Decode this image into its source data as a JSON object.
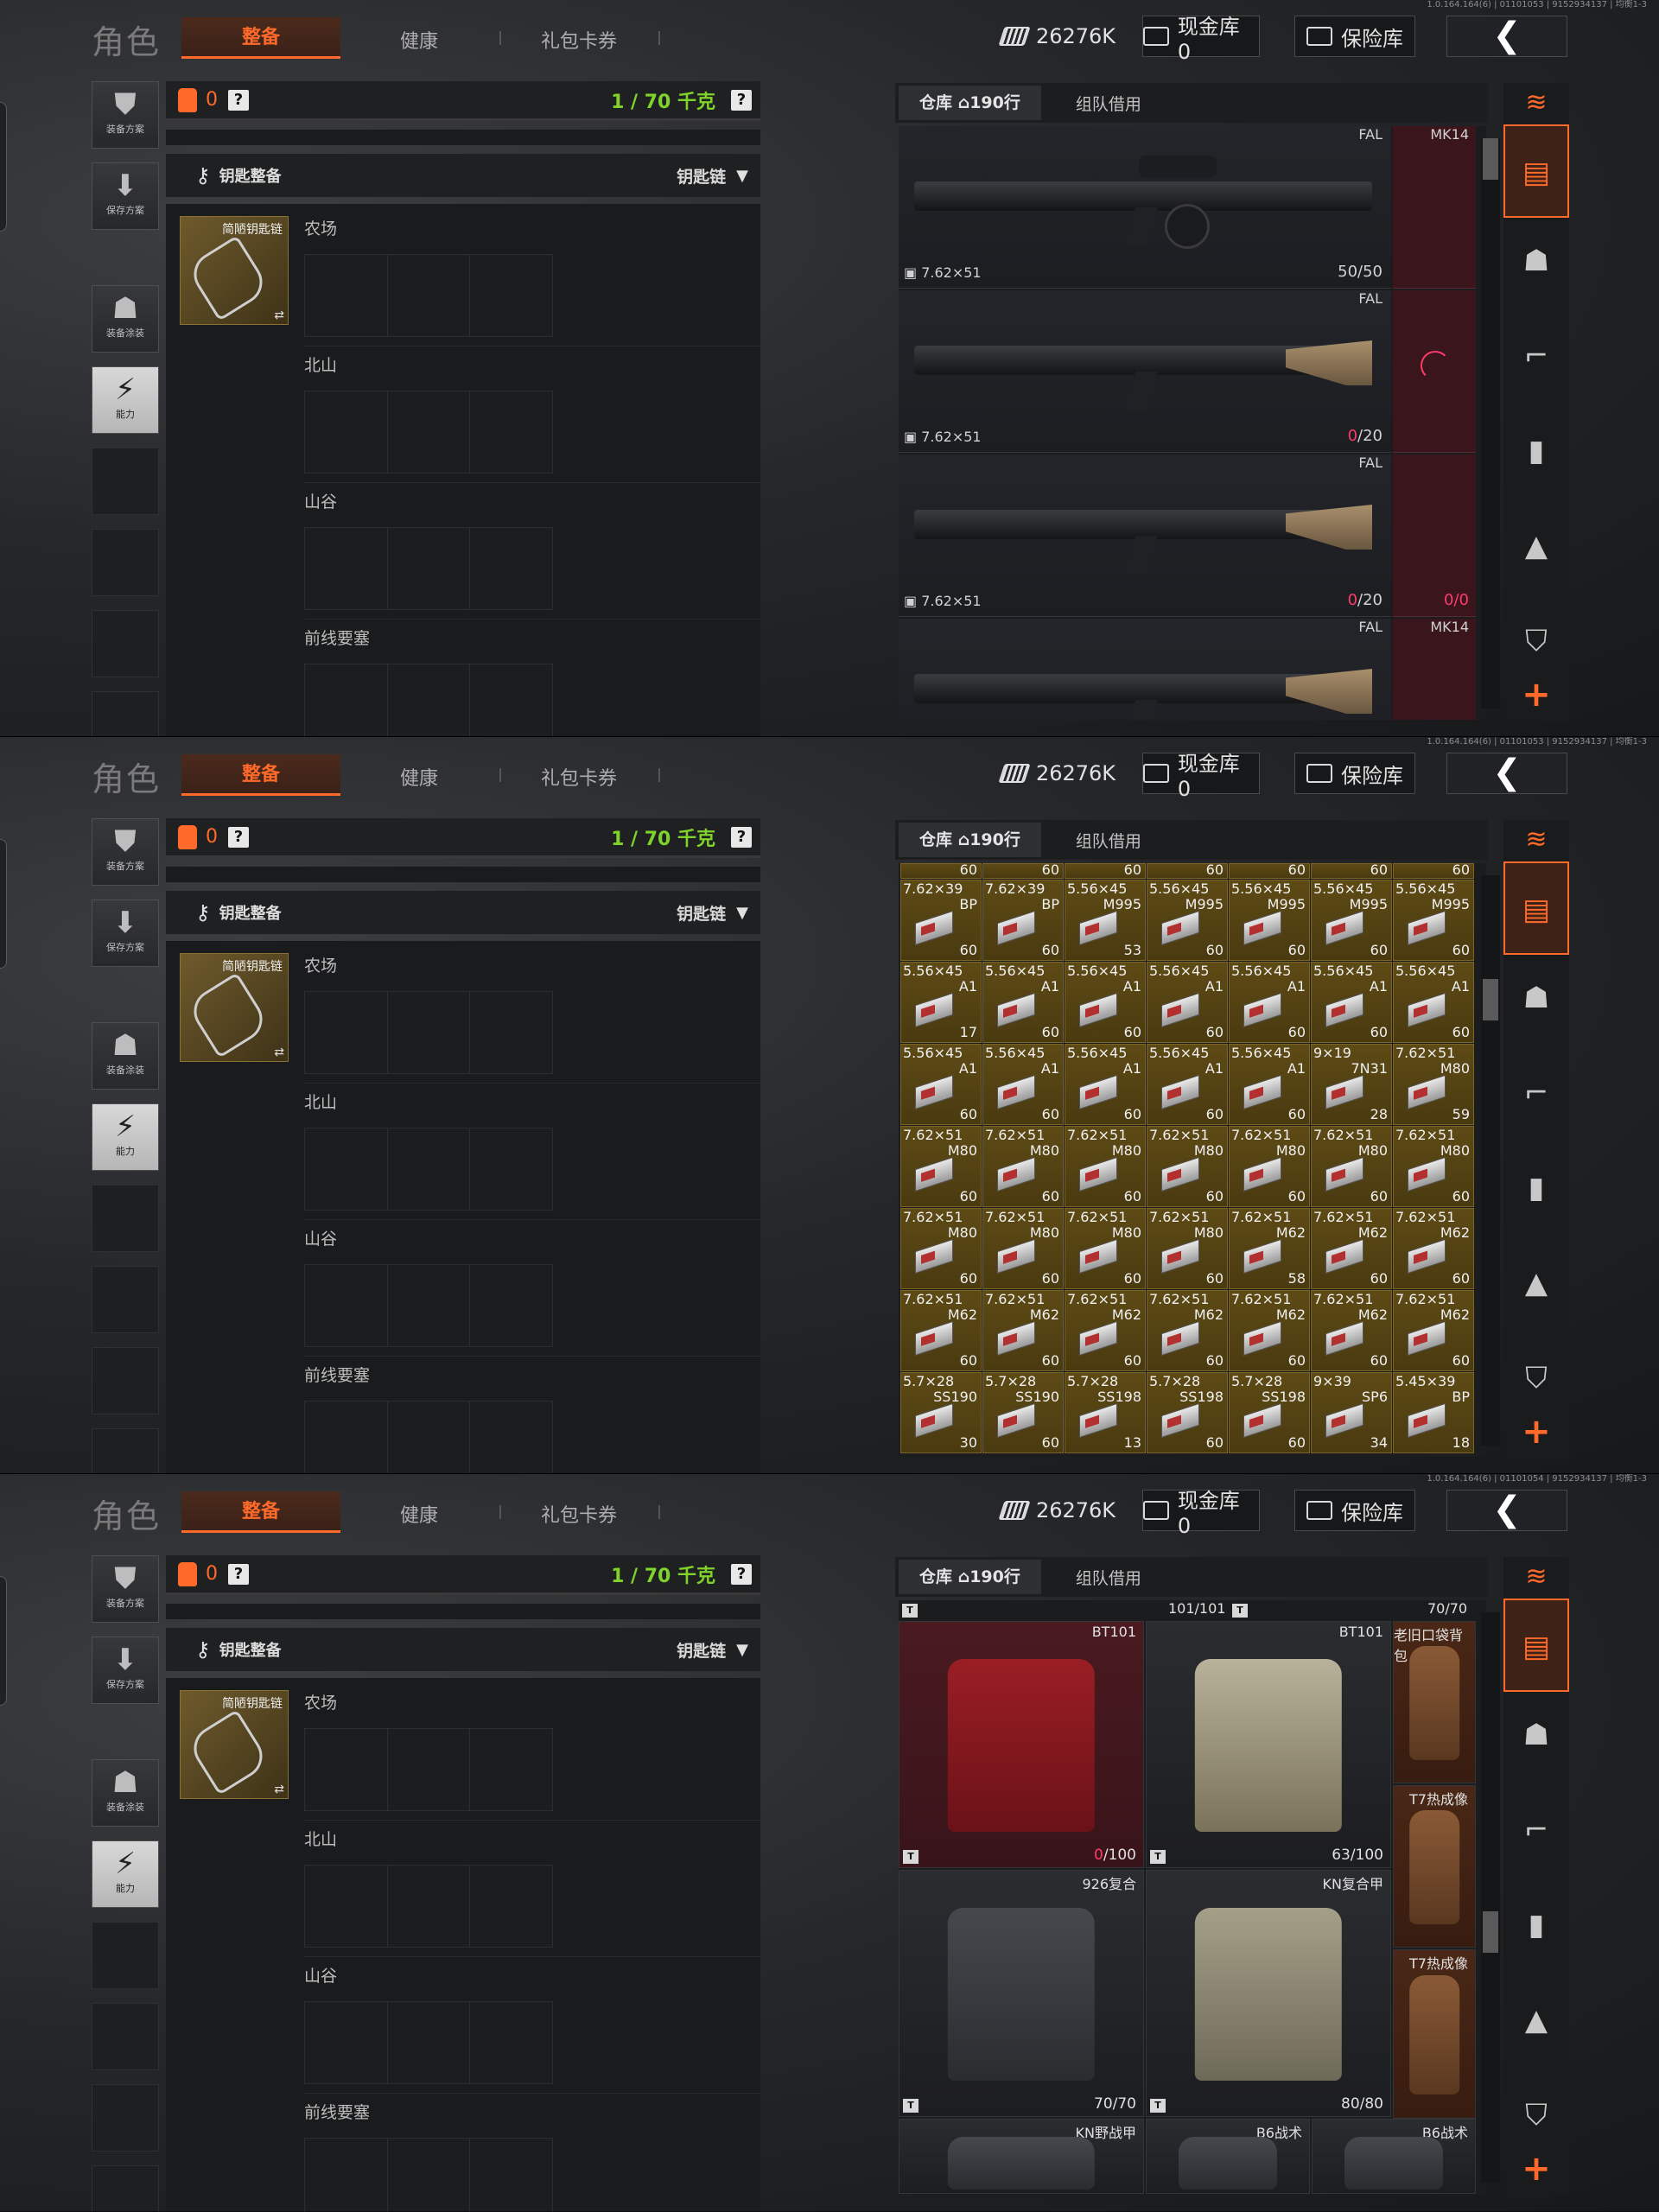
{
  "screens": [
    {
      "version": "1.0.164.164(6) | 01101053 | 9152934137 | 均衡1-3"
    },
    {
      "version": "1.0.164.164(6) | 01101053 | 9152934137 | 均衡1-3"
    },
    {
      "version": "1.0.164.164(6) | 01101054 | 9152934137 | 均衡1-3"
    }
  ],
  "nav": {
    "title": "角色",
    "tab_active": "整备",
    "tab_health": "健康",
    "tab_gift": "礼包卡券",
    "cash": "26276K",
    "gold_vault": "现金库 0",
    "safe_vault": "保险库",
    "back": "❮"
  },
  "sidebar": {
    "loadout": "装备方案",
    "save": "保存方案",
    "skin": "装备涂装",
    "ability": "能力"
  },
  "weight": {
    "count": "0",
    "value": "1 / 70 千克",
    "help": "?"
  },
  "keys": {
    "header": "钥匙整备",
    "chain": "钥匙链",
    "item_name": "简陋钥匙链",
    "sections": [
      "农场",
      "北山",
      "山谷",
      "前线要塞"
    ]
  },
  "warehouse": {
    "tab_main": "仓库 ⌂190行",
    "tab_team": "组队借用"
  },
  "guns": [
    {
      "name": "FAL",
      "caliber": "7.62×51",
      "count": "50/50",
      "bad": "",
      "slot": "MK14",
      "slot_count": "",
      "variant": "drum"
    },
    {
      "name": "FAL",
      "caliber": "7.62×51",
      "count": "/20",
      "bad": "0",
      "slot": "",
      "slot_count": "",
      "variant": "tan"
    },
    {
      "name": "FAL",
      "caliber": "7.62×51",
      "count": "/20",
      "bad": "0",
      "slot": "",
      "slot_count": "0/0",
      "variant": "tan"
    },
    {
      "name": "FAL",
      "caliber": "",
      "count": "",
      "bad": "",
      "slot": "MK14",
      "slot_count": "",
      "variant": "tan"
    }
  ],
  "ammo_partial": [
    "60",
    "60",
    "60",
    "60",
    "60",
    "60",
    "60"
  ],
  "ammo": [
    {
      "cal": "7.62×39",
      "var": "BP",
      "n": "60"
    },
    {
      "cal": "7.62×39",
      "var": "BP",
      "n": "60"
    },
    {
      "cal": "5.56×45",
      "var": "M995",
      "n": "53"
    },
    {
      "cal": "5.56×45",
      "var": "M995",
      "n": "60"
    },
    {
      "cal": "5.56×45",
      "var": "M995",
      "n": "60"
    },
    {
      "cal": "5.56×45",
      "var": "M995",
      "n": "60"
    },
    {
      "cal": "5.56×45",
      "var": "M995",
      "n": "60"
    },
    {
      "cal": "5.56×45",
      "var": "A1",
      "n": "17"
    },
    {
      "cal": "5.56×45",
      "var": "A1",
      "n": "60"
    },
    {
      "cal": "5.56×45",
      "var": "A1",
      "n": "60"
    },
    {
      "cal": "5.56×45",
      "var": "A1",
      "n": "60"
    },
    {
      "cal": "5.56×45",
      "var": "A1",
      "n": "60"
    },
    {
      "cal": "5.56×45",
      "var": "A1",
      "n": "60"
    },
    {
      "cal": "5.56×45",
      "var": "A1",
      "n": "60"
    },
    {
      "cal": "5.56×45",
      "var": "A1",
      "n": "60"
    },
    {
      "cal": "5.56×45",
      "var": "A1",
      "n": "60"
    },
    {
      "cal": "5.56×45",
      "var": "A1",
      "n": "60"
    },
    {
      "cal": "5.56×45",
      "var": "A1",
      "n": "60"
    },
    {
      "cal": "5.56×45",
      "var": "A1",
      "n": "60"
    },
    {
      "cal": "9×19",
      "var": "7N31",
      "n": "28"
    },
    {
      "cal": "7.62×51",
      "var": "M80",
      "n": "59"
    },
    {
      "cal": "7.62×51",
      "var": "M80",
      "n": "60"
    },
    {
      "cal": "7.62×51",
      "var": "M80",
      "n": "60"
    },
    {
      "cal": "7.62×51",
      "var": "M80",
      "n": "60"
    },
    {
      "cal": "7.62×51",
      "var": "M80",
      "n": "60"
    },
    {
      "cal": "7.62×51",
      "var": "M80",
      "n": "60"
    },
    {
      "cal": "7.62×51",
      "var": "M80",
      "n": "60"
    },
    {
      "cal": "7.62×51",
      "var": "M80",
      "n": "60"
    },
    {
      "cal": "7.62×51",
      "var": "M80",
      "n": "60"
    },
    {
      "cal": "7.62×51",
      "var": "M80",
      "n": "60"
    },
    {
      "cal": "7.62×51",
      "var": "M80",
      "n": "60"
    },
    {
      "cal": "7.62×51",
      "var": "M80",
      "n": "60"
    },
    {
      "cal": "7.62×51",
      "var": "M62",
      "n": "58"
    },
    {
      "cal": "7.62×51",
      "var": "M62",
      "n": "60"
    },
    {
      "cal": "7.62×51",
      "var": "M62",
      "n": "60"
    },
    {
      "cal": "7.62×51",
      "var": "M62",
      "n": "60"
    },
    {
      "cal": "7.62×51",
      "var": "M62",
      "n": "60"
    },
    {
      "cal": "7.62×51",
      "var": "M62",
      "n": "60"
    },
    {
      "cal": "7.62×51",
      "var": "M62",
      "n": "60"
    },
    {
      "cal": "7.62×51",
      "var": "M62",
      "n": "60"
    },
    {
      "cal": "7.62×51",
      "var": "M62",
      "n": "60"
    },
    {
      "cal": "7.62×51",
      "var": "M62",
      "n": "60"
    },
    {
      "cal": "5.7×28",
      "var": "SS190",
      "n": "30"
    },
    {
      "cal": "5.7×28",
      "var": "SS190",
      "n": "60"
    },
    {
      "cal": "5.7×28",
      "var": "SS198",
      "n": "13"
    },
    {
      "cal": "5.7×28",
      "var": "SS198",
      "n": "60"
    },
    {
      "cal": "5.7×28",
      "var": "SS198",
      "n": "60"
    },
    {
      "cal": "9×39",
      "var": "SP6",
      "n": "34"
    },
    {
      "cal": "5.45×39",
      "var": "BP",
      "n": "18"
    }
  ],
  "armor_top": {
    "a": "101/101",
    "b": "70/70"
  },
  "armor": [
    {
      "name": "BT101",
      "count": "/100",
      "bad": "0",
      "style": "red"
    },
    {
      "name": "BT101",
      "count": "63/100",
      "bad": "",
      "style": "camo"
    },
    {
      "name": "老旧口袋背包",
      "count": "",
      "bad": "",
      "style": "orange"
    },
    {
      "name": "T7热成像",
      "count": "",
      "bad": "",
      "style": "orange"
    },
    {
      "name": "926复合",
      "count": "70/70",
      "bad": "",
      "style": "dark"
    },
    {
      "name": "KN复合甲",
      "count": "80/80",
      "bad": "",
      "style": "tan"
    },
    {
      "name": "T7热成像",
      "count": "",
      "bad": "",
      "style": "orange"
    },
    {
      "name": "KN野战甲",
      "count": "",
      "bad": "",
      "style": "dark"
    },
    {
      "name": "B6战术",
      "count": "",
      "bad": "",
      "style": "dark"
    },
    {
      "name": "B6战术",
      "count": "",
      "bad": "",
      "style": "dark"
    }
  ]
}
